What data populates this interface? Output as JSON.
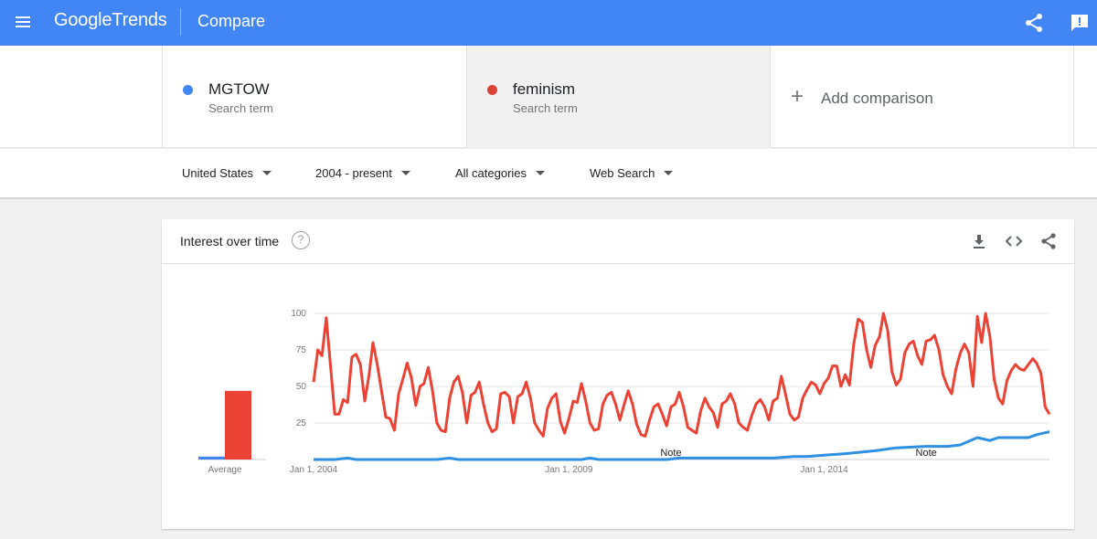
{
  "header": {
    "logo_google": "Google",
    "logo_trends": "Trends",
    "title": "Compare",
    "color": "#4285f4"
  },
  "terms": [
    {
      "name": "MGTOW",
      "sub": "Search term",
      "color": "#4285f4"
    },
    {
      "name": "feminism",
      "sub": "Search term",
      "color": "#db4437"
    }
  ],
  "add_comparison": {
    "plus": "+",
    "label": "Add comparison"
  },
  "filters": {
    "region": "United States",
    "time": "2004 - present",
    "category": "All categories",
    "search_type": "Web Search"
  },
  "card": {
    "title": "Interest over time",
    "help": "?"
  },
  "chart_data": {
    "type": "line",
    "ylim": [
      0,
      100
    ],
    "y_ticks": [
      25,
      50,
      75,
      100
    ],
    "x_range": [
      "2004-01-01",
      "2018-06-01"
    ],
    "x_ticks": [
      {
        "date": "2004-01-01",
        "label": "Jan 1, 2004"
      },
      {
        "date": "2009-01-01",
        "label": "Jan 1, 2009"
      },
      {
        "date": "2014-01-01",
        "label": "Jan 1, 2014"
      }
    ],
    "notes": [
      {
        "date": "2011-01-01",
        "label": "Note"
      },
      {
        "date": "2016-01-01",
        "label": "Note"
      }
    ],
    "average": {
      "label": "Average",
      "values": [
        2,
        47
      ]
    },
    "series": [
      {
        "name": "MGTOW",
        "color": "#4285f4",
        "values": [
          {
            "x": "2004-01-01",
            "y": 0
          },
          {
            "x": "2004-06-01",
            "y": 0
          },
          {
            "x": "2004-09-01",
            "y": 1
          },
          {
            "x": "2004-11-01",
            "y": 0
          },
          {
            "x": "2006-06-01",
            "y": 0
          },
          {
            "x": "2006-09-01",
            "y": 1
          },
          {
            "x": "2006-11-01",
            "y": 0
          },
          {
            "x": "2009-04-01",
            "y": 0
          },
          {
            "x": "2009-06-01",
            "y": 1
          },
          {
            "x": "2009-08-01",
            "y": 0
          },
          {
            "x": "2010-12-01",
            "y": 0
          },
          {
            "x": "2011-03-01",
            "y": 1
          },
          {
            "x": "2013-01-01",
            "y": 1
          },
          {
            "x": "2013-06-01",
            "y": 2
          },
          {
            "x": "2013-09-01",
            "y": 2
          },
          {
            "x": "2014-01-01",
            "y": 3
          },
          {
            "x": "2014-06-01",
            "y": 4
          },
          {
            "x": "2015-01-01",
            "y": 6
          },
          {
            "x": "2015-06-01",
            "y": 8
          },
          {
            "x": "2016-01-01",
            "y": 9
          },
          {
            "x": "2016-06-01",
            "y": 9
          },
          {
            "x": "2016-09-01",
            "y": 10
          },
          {
            "x": "2017-01-01",
            "y": 15
          },
          {
            "x": "2017-04-01",
            "y": 13
          },
          {
            "x": "2017-06-01",
            "y": 15
          },
          {
            "x": "2018-01-01",
            "y": 15
          },
          {
            "x": "2018-03-01",
            "y": 17
          },
          {
            "x": "2018-06-01",
            "y": 19
          }
        ]
      },
      {
        "name": "feminism",
        "color": "#db4437",
        "values": [
          {
            "x": "2004-01-01",
            "y": 53
          },
          {
            "x": "2004-02-01",
            "y": 75
          },
          {
            "x": "2004-03-01",
            "y": 71
          },
          {
            "x": "2004-04-01",
            "y": 97
          },
          {
            "x": "2004-06-01",
            "y": 31
          },
          {
            "x": "2004-07-01",
            "y": 31
          },
          {
            "x": "2004-08-01",
            "y": 41
          },
          {
            "x": "2004-09-01",
            "y": 39
          },
          {
            "x": "2004-10-01",
            "y": 70
          },
          {
            "x": "2004-11-01",
            "y": 72
          },
          {
            "x": "2004-12-01",
            "y": 65
          },
          {
            "x": "2005-01-01",
            "y": 40
          },
          {
            "x": "2005-02-01",
            "y": 58
          },
          {
            "x": "2005-03-01",
            "y": 80
          },
          {
            "x": "2005-04-01",
            "y": 65
          },
          {
            "x": "2005-06-01",
            "y": 29
          },
          {
            "x": "2005-07-01",
            "y": 28
          },
          {
            "x": "2005-08-01",
            "y": 20
          },
          {
            "x": "2005-09-01",
            "y": 45
          },
          {
            "x": "2005-10-01",
            "y": 55
          },
          {
            "x": "2005-11-01",
            "y": 66
          },
          {
            "x": "2005-12-01",
            "y": 56
          },
          {
            "x": "2006-01-01",
            "y": 37
          },
          {
            "x": "2006-02-01",
            "y": 50
          },
          {
            "x": "2006-03-01",
            "y": 52
          },
          {
            "x": "2006-04-01",
            "y": 63
          },
          {
            "x": "2006-05-01",
            "y": 47
          },
          {
            "x": "2006-06-01",
            "y": 25
          },
          {
            "x": "2006-07-01",
            "y": 20
          },
          {
            "x": "2006-08-01",
            "y": 19
          },
          {
            "x": "2006-09-01",
            "y": 42
          },
          {
            "x": "2006-10-01",
            "y": 53
          },
          {
            "x": "2006-11-01",
            "y": 57
          },
          {
            "x": "2006-12-01",
            "y": 46
          },
          {
            "x": "2007-01-01",
            "y": 25
          },
          {
            "x": "2007-02-01",
            "y": 44
          },
          {
            "x": "2007-03-01",
            "y": 46
          },
          {
            "x": "2007-04-01",
            "y": 53
          },
          {
            "x": "2007-05-01",
            "y": 38
          },
          {
            "x": "2007-06-01",
            "y": 25
          },
          {
            "x": "2007-07-01",
            "y": 19
          },
          {
            "x": "2007-08-01",
            "y": 21
          },
          {
            "x": "2007-09-01",
            "y": 45
          },
          {
            "x": "2007-10-01",
            "y": 46
          },
          {
            "x": "2007-11-01",
            "y": 43
          },
          {
            "x": "2007-12-01",
            "y": 25
          },
          {
            "x": "2008-01-01",
            "y": 43
          },
          {
            "x": "2008-02-01",
            "y": 45
          },
          {
            "x": "2008-03-01",
            "y": 53
          },
          {
            "x": "2008-04-01",
            "y": 42
          },
          {
            "x": "2008-05-01",
            "y": 25
          },
          {
            "x": "2008-06-01",
            "y": 20
          },
          {
            "x": "2008-07-01",
            "y": 16
          },
          {
            "x": "2008-08-01",
            "y": 35
          },
          {
            "x": "2008-09-01",
            "y": 42
          },
          {
            "x": "2008-10-01",
            "y": 45
          },
          {
            "x": "2008-11-01",
            "y": 26
          },
          {
            "x": "2008-12-01",
            "y": 18
          },
          {
            "x": "2009-01-01",
            "y": 28
          },
          {
            "x": "2009-02-01",
            "y": 40
          },
          {
            "x": "2009-03-01",
            "y": 39
          },
          {
            "x": "2009-04-01",
            "y": 52
          },
          {
            "x": "2009-05-01",
            "y": 40
          },
          {
            "x": "2009-06-01",
            "y": 25
          },
          {
            "x": "2009-07-01",
            "y": 20
          },
          {
            "x": "2009-08-01",
            "y": 21
          },
          {
            "x": "2009-09-01",
            "y": 38
          },
          {
            "x": "2009-10-01",
            "y": 44
          },
          {
            "x": "2009-11-01",
            "y": 46
          },
          {
            "x": "2009-12-01",
            "y": 38
          },
          {
            "x": "2010-01-01",
            "y": 27
          },
          {
            "x": "2010-02-01",
            "y": 38
          },
          {
            "x": "2010-03-01",
            "y": 47
          },
          {
            "x": "2010-04-01",
            "y": 38
          },
          {
            "x": "2010-05-01",
            "y": 24
          },
          {
            "x": "2010-06-01",
            "y": 17
          },
          {
            "x": "2010-07-01",
            "y": 16
          },
          {
            "x": "2010-08-01",
            "y": 27
          },
          {
            "x": "2010-09-01",
            "y": 36
          },
          {
            "x": "2010-10-01",
            "y": 38
          },
          {
            "x": "2010-11-01",
            "y": 31
          },
          {
            "x": "2010-12-01",
            "y": 23
          },
          {
            "x": "2011-01-01",
            "y": 36
          },
          {
            "x": "2011-02-01",
            "y": 38
          },
          {
            "x": "2011-03-01",
            "y": 46
          },
          {
            "x": "2011-04-01",
            "y": 36
          },
          {
            "x": "2011-05-01",
            "y": 22
          },
          {
            "x": "2011-06-01",
            "y": 20
          },
          {
            "x": "2011-07-01",
            "y": 18
          },
          {
            "x": "2011-08-01",
            "y": 33
          },
          {
            "x": "2011-09-01",
            "y": 42
          },
          {
            "x": "2011-10-01",
            "y": 36
          },
          {
            "x": "2011-11-01",
            "y": 32
          },
          {
            "x": "2011-12-01",
            "y": 22
          },
          {
            "x": "2012-01-01",
            "y": 38
          },
          {
            "x": "2012-02-01",
            "y": 40
          },
          {
            "x": "2012-03-01",
            "y": 45
          },
          {
            "x": "2012-04-01",
            "y": 38
          },
          {
            "x": "2012-05-01",
            "y": 25
          },
          {
            "x": "2012-06-01",
            "y": 22
          },
          {
            "x": "2012-07-01",
            "y": 20
          },
          {
            "x": "2012-08-01",
            "y": 30
          },
          {
            "x": "2012-09-01",
            "y": 38
          },
          {
            "x": "2012-10-01",
            "y": 41
          },
          {
            "x": "2012-11-01",
            "y": 36
          },
          {
            "x": "2012-12-01",
            "y": 27
          },
          {
            "x": "2013-01-01",
            "y": 40
          },
          {
            "x": "2013-02-01",
            "y": 42
          },
          {
            "x": "2013-03-01",
            "y": 57
          },
          {
            "x": "2013-04-01",
            "y": 44
          },
          {
            "x": "2013-05-01",
            "y": 31
          },
          {
            "x": "2013-06-01",
            "y": 27
          },
          {
            "x": "2013-07-01",
            "y": 29
          },
          {
            "x": "2013-08-01",
            "y": 42
          },
          {
            "x": "2013-09-01",
            "y": 48
          },
          {
            "x": "2013-10-01",
            "y": 53
          },
          {
            "x": "2013-11-01",
            "y": 51
          },
          {
            "x": "2013-12-01",
            "y": 45
          },
          {
            "x": "2014-01-01",
            "y": 52
          },
          {
            "x": "2014-02-01",
            "y": 56
          },
          {
            "x": "2014-03-01",
            "y": 64
          },
          {
            "x": "2014-04-01",
            "y": 64
          },
          {
            "x": "2014-05-01",
            "y": 50
          },
          {
            "x": "2014-06-01",
            "y": 58
          },
          {
            "x": "2014-07-01",
            "y": 51
          },
          {
            "x": "2014-08-01",
            "y": 79
          },
          {
            "x": "2014-09-01",
            "y": 96
          },
          {
            "x": "2014-10-01",
            "y": 94
          },
          {
            "x": "2014-11-01",
            "y": 75
          },
          {
            "x": "2014-12-01",
            "y": 63
          },
          {
            "x": "2015-01-01",
            "y": 78
          },
          {
            "x": "2015-02-01",
            "y": 84
          },
          {
            "x": "2015-03-01",
            "y": 100
          },
          {
            "x": "2015-04-01",
            "y": 88
          },
          {
            "x": "2015-05-01",
            "y": 60
          },
          {
            "x": "2015-06-01",
            "y": 51
          },
          {
            "x": "2015-07-01",
            "y": 55
          },
          {
            "x": "2015-08-01",
            "y": 73
          },
          {
            "x": "2015-09-01",
            "y": 79
          },
          {
            "x": "2015-10-01",
            "y": 81
          },
          {
            "x": "2015-11-01",
            "y": 71
          },
          {
            "x": "2015-12-01",
            "y": 65
          },
          {
            "x": "2016-01-01",
            "y": 81
          },
          {
            "x": "2016-02-01",
            "y": 82
          },
          {
            "x": "2016-03-01",
            "y": 85
          },
          {
            "x": "2016-04-01",
            "y": 75
          },
          {
            "x": "2016-05-01",
            "y": 58
          },
          {
            "x": "2016-06-01",
            "y": 50
          },
          {
            "x": "2016-07-01",
            "y": 45
          },
          {
            "x": "2016-08-01",
            "y": 62
          },
          {
            "x": "2016-09-01",
            "y": 73
          },
          {
            "x": "2016-10-01",
            "y": 79
          },
          {
            "x": "2016-11-01",
            "y": 73
          },
          {
            "x": "2016-12-01",
            "y": 50
          },
          {
            "x": "2017-01-01",
            "y": 98
          },
          {
            "x": "2017-02-01",
            "y": 80
          },
          {
            "x": "2017-03-01",
            "y": 100
          },
          {
            "x": "2017-04-01",
            "y": 84
          },
          {
            "x": "2017-05-01",
            "y": 55
          },
          {
            "x": "2017-06-01",
            "y": 42
          },
          {
            "x": "2017-07-01",
            "y": 38
          },
          {
            "x": "2017-08-01",
            "y": 54
          },
          {
            "x": "2017-09-01",
            "y": 61
          },
          {
            "x": "2017-10-01",
            "y": 65
          },
          {
            "x": "2017-11-01",
            "y": 62
          },
          {
            "x": "2017-12-01",
            "y": 61
          },
          {
            "x": "2018-01-01",
            "y": 65
          },
          {
            "x": "2018-02-01",
            "y": 69
          },
          {
            "x": "2018-03-01",
            "y": 66
          },
          {
            "x": "2018-04-01",
            "y": 59
          },
          {
            "x": "2018-05-01",
            "y": 36
          },
          {
            "x": "2018-06-01",
            "y": 31
          }
        ]
      }
    ]
  }
}
